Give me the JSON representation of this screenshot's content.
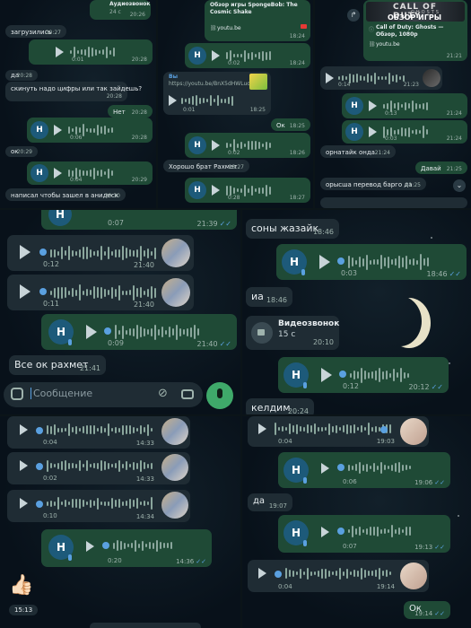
{
  "panel_a": {
    "call": {
      "title": "Аудиозвонок",
      "sub": "24 с",
      "time": "20:26"
    },
    "msg1": {
      "text": "загрузились",
      "time": "20:27"
    },
    "voice1": {
      "dur": "0:01",
      "time": "20:28"
    },
    "msg2": {
      "text": "да",
      "time": "20:28"
    },
    "msg3": {
      "text": "скинуть надо цифры или так зайдешь?",
      "time": "20:28"
    },
    "msg4": {
      "text": "Нет",
      "time": "20:28"
    },
    "voice2": {
      "dur": "0:06",
      "time": "20:28"
    },
    "msg5": {
      "text": "ок",
      "time": "20:29"
    },
    "voice3": {
      "dur": "0:04",
      "time": "20:29"
    },
    "msg6": {
      "text": "написал чтобы зашел в анидеск",
      "time": "20:30"
    }
  },
  "panel_b": {
    "link1": {
      "title": "Обзор игры SpongeBob: The Cosmic Shake",
      "domain": "youtu.be",
      "time": "18:24"
    },
    "voice1": {
      "dur": "0:02",
      "time": "18:24"
    },
    "voice2": {
      "dur": "0:02",
      "time": "18:24"
    },
    "reply": {
      "name": "Вы",
      "quote": "https://youtu.be/BnX5dHWLuoc",
      "dur": "0:01",
      "time": "18:25"
    },
    "msg_ok": {
      "text": "Ок",
      "time": "18:25"
    },
    "voice3": {
      "dur": "0:02",
      "time": "18:26"
    },
    "msg2": {
      "text": "Хорошо брат Рахмет",
      "time": "18:27"
    },
    "voice4": {
      "dur": "0:28",
      "time": "18:27"
    }
  },
  "panel_c": {
    "link": {
      "banner": "CALL OF DUTY",
      "banner_sub": "GHOSTS",
      "banner_caption": "ОБЗОР ИГРЫ",
      "title": "Call of Duty: Ghosts — Обзор, 1080р",
      "domain": "youtu.be",
      "time": "21:21"
    },
    "voice1": {
      "dur": "0:14",
      "time": "21:23"
    },
    "voice2": {
      "dur": "0:13",
      "time": "21:24"
    },
    "voice3": {
      "dur": "0:03",
      "time": "21:24"
    },
    "msg1": {
      "text": "орнатайк онда",
      "time": "21:24"
    },
    "msg2": {
      "text": "Давай",
      "time": "21:25"
    },
    "msg3": {
      "text": "орысша перевод барго да",
      "time": "21:25"
    }
  },
  "panel_d": {
    "voice0": {
      "dur": "0:07",
      "time": "21:39"
    },
    "voice1": {
      "dur": "0:12",
      "time": "21:40"
    },
    "voice2": {
      "dur": "0:11",
      "time": "21:40"
    },
    "voice3": {
      "dur": "0:09",
      "time": "21:40"
    },
    "msg1": {
      "text": "Все ок рахмет",
      "time": "21:41"
    },
    "input": {
      "placeholder": "Сообщение"
    }
  },
  "panel_e": {
    "msg1": {
      "text": "соны жазайк",
      "time": "18:46"
    },
    "voice1": {
      "dur": "0:03",
      "time": "18:46"
    },
    "msg2": {
      "text": "иа",
      "time": "18:46"
    },
    "call": {
      "title": "Видеозвонок",
      "sub": "15 с",
      "time": "20:10"
    },
    "voice2": {
      "dur": "0:12",
      "time": "20:12"
    },
    "msg3": {
      "text": "келдим",
      "time": "20:24"
    }
  },
  "panel_f": {
    "voice1": {
      "dur": "0:04",
      "time": "14:33"
    },
    "voice2": {
      "dur": "0:02",
      "time": "14:33"
    },
    "voice3": {
      "dur": "0:10",
      "time": "14:34"
    },
    "voice4": {
      "dur": "0:20",
      "time": "14:36"
    },
    "emoji": "👍🏻",
    "emoji_time": "15:13"
  },
  "panel_g": {
    "voice1": {
      "dur": "0:04",
      "time": "19:03"
    },
    "voice2": {
      "dur": "0:06",
      "time": "19:06"
    },
    "msg1": {
      "text": "да",
      "time": "19:07"
    },
    "voice3": {
      "dur": "0:07",
      "time": "19:13"
    },
    "voice4": {
      "dur": "0:04",
      "time": "19:14"
    },
    "msg2": {
      "text": "Ок",
      "time": "19:14"
    }
  },
  "avatar_letter": "Н",
  "colors": {
    "outgoing": "#1f4a36",
    "incoming": "#1f2c34",
    "accent": "#5aa0e0",
    "send_button": "#3fa96a"
  }
}
